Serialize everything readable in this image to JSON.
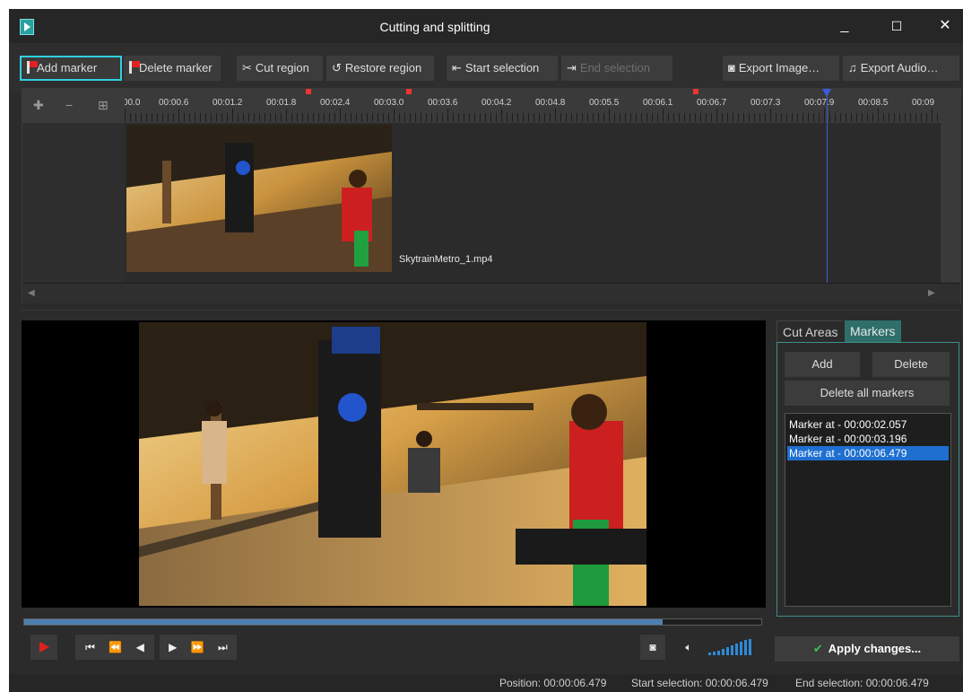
{
  "window": {
    "title": "Cutting and splitting",
    "minimize": "_",
    "maximize": "☐",
    "close": "✕"
  },
  "toolbar": {
    "add_marker": "Add marker",
    "delete_marker": "Delete marker",
    "cut_region": "Cut region",
    "restore_region": "Restore region",
    "start_selection": "Start selection",
    "end_selection": "End selection",
    "export_image": "Export Image…",
    "export_audio": "Export Audio…"
  },
  "timeline": {
    "ruler_labels": [
      "00.0",
      "00:00.6",
      "00:01.2",
      "00:01.8",
      "00:02.4",
      "00:03.0",
      "00:03.6",
      "00:04.2",
      "00:04.8",
      "00:05.5",
      "00:06.1",
      "00:06.7",
      "00:07.3",
      "00:07.9",
      "00:08.5",
      "00:09"
    ],
    "clip_name": "SkytrainMetro_1.mp4"
  },
  "player": {
    "progress": 0.866
  },
  "side": {
    "tab_cut_areas": "Cut Areas",
    "tab_markers": "Markers",
    "add": "Add",
    "delete": "Delete",
    "delete_all": "Delete all markers",
    "markers": [
      "Marker at - 00:00:02.057",
      "Marker at - 00:00:03.196",
      "Marker at - 00:00:06.479"
    ],
    "selected_index": 2
  },
  "apply": "Apply changes...",
  "status": {
    "position": "Position: 00:00:06.479",
    "start_selection": "Start selection: 00:00:06.479",
    "end_selection": "End selection: 00:00:06.479"
  }
}
